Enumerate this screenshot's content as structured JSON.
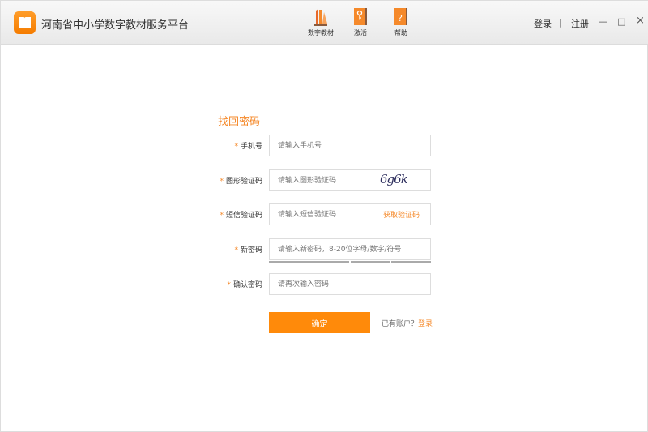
{
  "app": {
    "title": "河南省中小学数字教材服务平台",
    "accent": "#ff8a0a"
  },
  "nav": [
    {
      "label": "数字教材",
      "icon": "books-icon"
    },
    {
      "label": "激活",
      "icon": "key-book-icon"
    },
    {
      "label": "帮助",
      "icon": "help-book-icon"
    }
  ],
  "header": {
    "login": "登录",
    "separator": "|",
    "register": "注册"
  },
  "window": {
    "minimize": "—",
    "maximize": "□",
    "close": "×"
  },
  "form": {
    "title": "找回密码",
    "required_mark": "*",
    "fields": [
      {
        "label": "手机号",
        "placeholder": "请输入手机号"
      },
      {
        "label": "图形验证码",
        "placeholder": "请输入图形验证码",
        "captcha": "6g6k"
      },
      {
        "label": "短信验证码",
        "placeholder": "请输入短信验证码",
        "action": "获取验证码"
      },
      {
        "label": "新密码",
        "placeholder": "请输入新密码，8-20位字母/数字/符号"
      },
      {
        "label": "确认密码",
        "placeholder": "请再次输入密码"
      }
    ],
    "submit": "确定",
    "has_account": "已有账户？",
    "login_link": "登录"
  }
}
